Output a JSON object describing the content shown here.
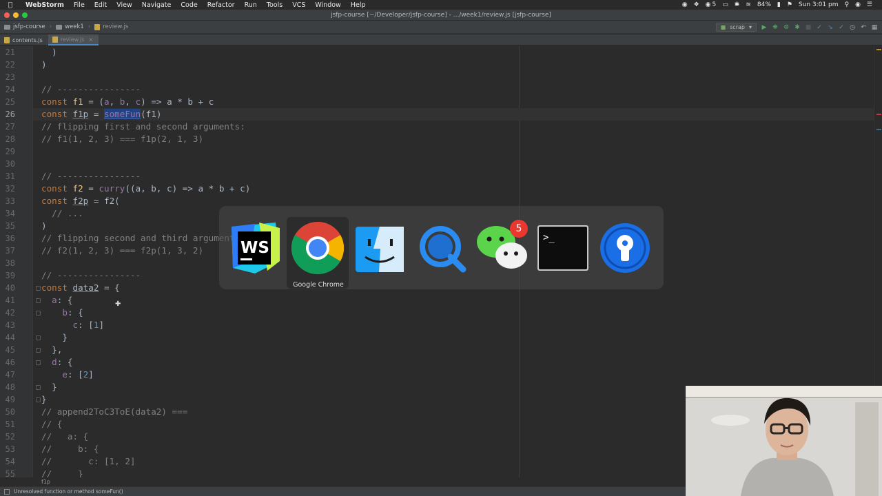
{
  "menubar": {
    "app": "WebStorm",
    "items": [
      "File",
      "Edit",
      "View",
      "Navigate",
      "Code",
      "Refactor",
      "Run",
      "Tools",
      "VCS",
      "Window",
      "Help"
    ],
    "wechat_count": "5",
    "battery": "84%",
    "clock": "Sun 3:01 pm"
  },
  "window": {
    "title": "jsfp-course [~/Developer/jsfp-course] - .../week1/review.js [jsfp-course]"
  },
  "navbar": {
    "crumbs": [
      "jsfp-course",
      "week1",
      "review.js"
    ],
    "run_config": "scrap"
  },
  "tabs": [
    {
      "label": "contents.js",
      "active": false
    },
    {
      "label": "review.js",
      "active": true
    }
  ],
  "editor": {
    "line_numbers": [
      "21",
      "22",
      "23",
      "24",
      "25",
      "26",
      "27",
      "28",
      "29",
      "30",
      "31",
      "32",
      "33",
      "34",
      "35",
      "36",
      "37",
      "38",
      "39",
      "40",
      "41",
      "42",
      "43",
      "44",
      "45",
      "46",
      "47",
      "48",
      "49",
      "50",
      "51",
      "52",
      "53",
      "54",
      "55"
    ],
    "current_line": "26",
    "breadcrumb": "f1p"
  },
  "switcher": {
    "apps": [
      "WebStorm",
      "Google Chrome",
      "Finder",
      "QuickTime Player",
      "WeChat",
      "Terminal",
      "1Password"
    ],
    "selected": "Google Chrome",
    "wechat_badge": "5"
  },
  "status": {
    "message": "Unresolved function or method someFun()"
  },
  "colors": {
    "editor_bg": "#2b2b2b",
    "keyword": "#cc7832",
    "comment": "#808080",
    "function": "#ffc66d",
    "property": "#9876aa",
    "selection": "#214283"
  }
}
